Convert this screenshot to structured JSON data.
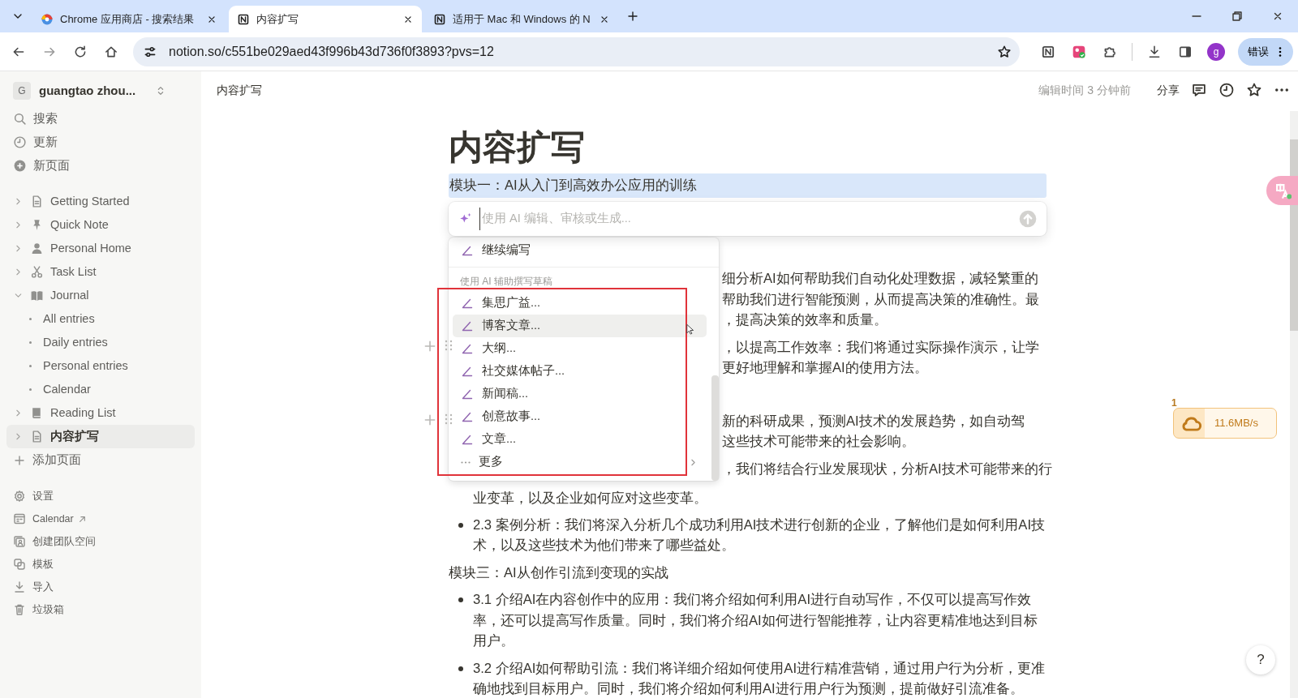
{
  "browser": {
    "tabs": [
      {
        "title": "Chrome 应用商店 - 搜索结果",
        "kind": "store",
        "selected": false
      },
      {
        "title": "内容扩写",
        "kind": "notion",
        "selected": true
      },
      {
        "title": "适用于 Mac 和 Windows 的 N",
        "kind": "notion",
        "selected": false
      }
    ],
    "url": "notion.so/c551be029aed43f996b43d736f0f3893?pvs=12",
    "profile": "g",
    "status_button": "错误"
  },
  "sidebar": {
    "workspace": {
      "initial": "G",
      "name": "guangtao zhou..."
    },
    "actions": [
      {
        "label": "搜索"
      },
      {
        "label": "更新"
      },
      {
        "label": "新页面"
      }
    ],
    "pages": [
      {
        "label": "Getting Started",
        "expanded": false,
        "selected": false
      },
      {
        "label": "Quick Note",
        "expanded": false,
        "selected": false
      },
      {
        "label": "Personal Home",
        "expanded": false,
        "selected": false
      },
      {
        "label": "Task List",
        "expanded": false,
        "selected": false
      },
      {
        "label": "Journal",
        "expanded": true,
        "selected": false,
        "children": [
          {
            "label": "All entries"
          },
          {
            "label": "Daily entries"
          },
          {
            "label": "Personal entries"
          },
          {
            "label": "Calendar"
          }
        ]
      },
      {
        "label": "Reading List",
        "expanded": false,
        "selected": false
      },
      {
        "label": "内容扩写",
        "expanded": false,
        "selected": true
      }
    ],
    "add_page": "添加页面",
    "footer": [
      {
        "label": "设置",
        "external": false
      },
      {
        "label": "Calendar",
        "external": true
      },
      {
        "label": "创建团队空间",
        "external": false
      },
      {
        "label": "模板",
        "external": false
      },
      {
        "label": "导入",
        "external": false
      },
      {
        "label": "垃圾箱",
        "external": false
      }
    ]
  },
  "topbar": {
    "breadcrumb": "内容扩写",
    "edited": "编辑时间 3 分钟前",
    "share": "分享"
  },
  "document": {
    "title": "内容扩写",
    "selected_block": {
      "text": "模块一：AI从入门到高效办公应用的训练",
      "selected": true
    },
    "ai_prompt": {
      "placeholder": "使用 AI 编辑、审核或生成..."
    },
    "ai_menu": {
      "top_item": "继续编写",
      "section": "使用 AI 辅助撰写草稿",
      "items": [
        {
          "label": "集思广益...",
          "kind": "draft",
          "selected": false
        },
        {
          "label": "博客文章...",
          "kind": "draft",
          "selected": true
        },
        {
          "label": "大纲...",
          "kind": "draft",
          "selected": false
        },
        {
          "label": "社交媒体帖子...",
          "kind": "draft",
          "selected": false
        },
        {
          "label": "新闻稿...",
          "kind": "draft",
          "selected": false
        },
        {
          "label": "创意故事...",
          "kind": "draft",
          "selected": false
        },
        {
          "label": "文章...",
          "kind": "draft",
          "selected": false
        },
        {
          "label": "更多",
          "kind": "more",
          "selected": false
        }
      ]
    },
    "partly_hidden_paragraphs": [
      {
        "lines": [
          "细分析AI如何帮助我们自动化处理数据，减轻繁重的",
          "帮助我们进行智能预测，从而提高决策的准确性。最",
          "，提高决策的效率和质量。"
        ],
        "handle": false
      },
      {
        "lines": [
          "，以提高工作效率：我们将通过实际操作演示，让学",
          "更好地理解和掌握AI的使用方法。"
        ],
        "handle": true
      },
      {
        "lines": [
          "新的科研成果，预测AI技术的发展趋势，如自动驾",
          "这些技术可能带来的社会影响。"
        ],
        "handle": true
      },
      {
        "lines": [
          "，我们将结合行业发展现状，分析AI技术可能带来的行"
        ],
        "handle": false
      }
    ],
    "continuation": "业变革，以及企业如何应对这些变革。",
    "blocks": [
      {
        "kind": "bullet",
        "text": "2.3 案例分析：我们将深入分析几个成功利用AI技术进行创新的企业，了解他们是如何利用AI技术，以及这些技术为他们带来了哪些益处。"
      },
      {
        "kind": "text",
        "text": "模块三：AI从创作引流到变现的实战"
      },
      {
        "kind": "bullet",
        "text": "3.1 介绍AI在内容创作中的应用：我们将介绍如何利用AI进行自动写作，不仅可以提高写作效率，还可以提高写作质量。同时，我们将介绍AI如何进行智能推荐，让内容更精准地达到目标用户。"
      },
      {
        "kind": "bullet",
        "text": "3.2 介绍AI如何帮助引流：我们将详细介绍如何使用AI进行精准营销，通过用户行为分析，更准确地找到目标用户。同时，我们将介绍如何利用AI进行用户行为预测，提前做好引流准备。"
      }
    ]
  },
  "download_widget": {
    "count": "1",
    "speed": "11.6MB/s"
  },
  "help": "?"
}
